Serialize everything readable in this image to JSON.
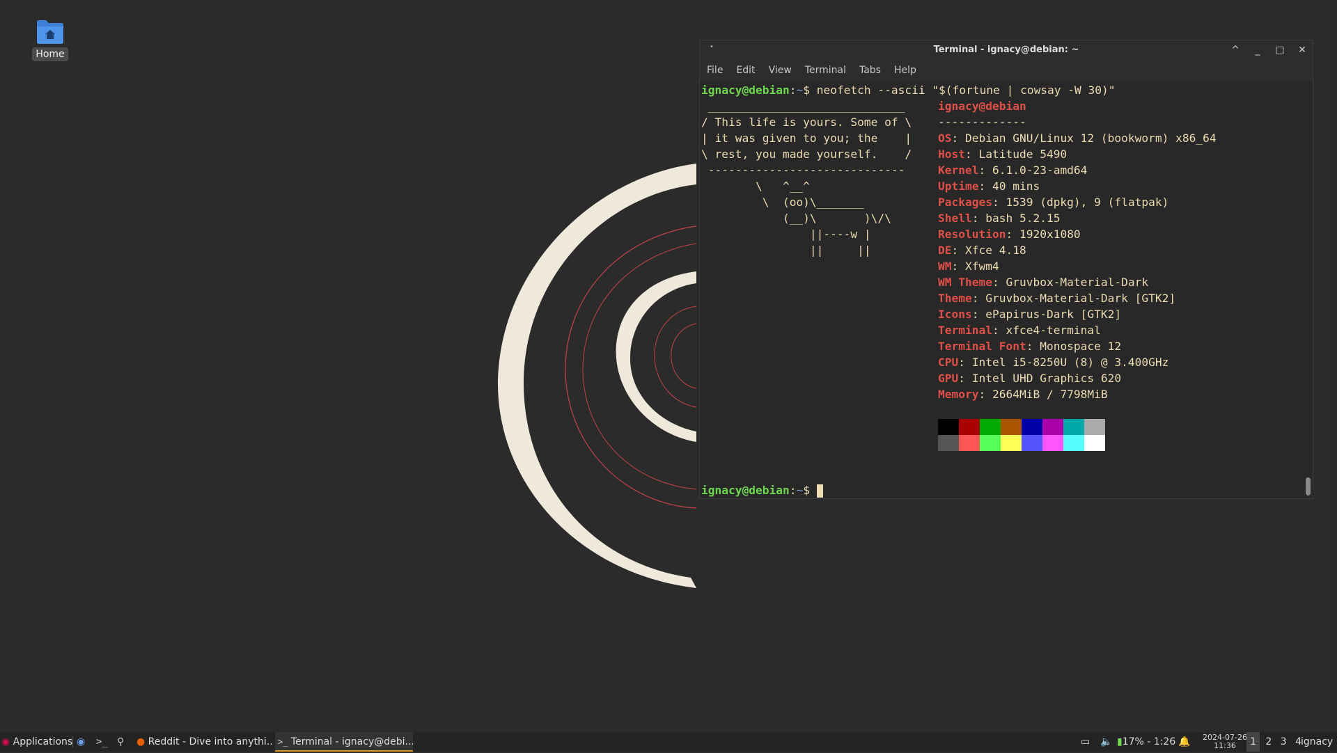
{
  "desktop": {
    "icons": [
      {
        "label": "Home",
        "icon": "home-folder-icon"
      }
    ]
  },
  "terminal": {
    "title": "Terminal - ignacy@debian: ~",
    "menu": [
      "File",
      "Edit",
      "View",
      "Terminal",
      "Tabs",
      "Help"
    ],
    "prompt_user": "ignacy@debian",
    "prompt_path": "~",
    "prompt_symbol": "$",
    "command": "neofetch --ascii \"$(fortune | cowsay -W 30)\"",
    "cowsay": [
      " _____________________________",
      "/ This life is yours. Some of \\",
      "| it was given to you; the    |",
      "\\ rest, you made yourself.    /",
      " -----------------------------",
      "        \\   ^__^",
      "         \\  (oo)\\_______",
      "            (__)\\       )\\/\\",
      "                ||----w |",
      "                ||     ||"
    ],
    "header": "ignacy@debian",
    "separator": "-------------",
    "info": [
      {
        "key": "OS",
        "value": "Debian GNU/Linux 12 (bookworm) x86_64"
      },
      {
        "key": "Host",
        "value": "Latitude 5490"
      },
      {
        "key": "Kernel",
        "value": "6.1.0-23-amd64"
      },
      {
        "key": "Uptime",
        "value": "40 mins"
      },
      {
        "key": "Packages",
        "value": "1539 (dpkg), 9 (flatpak)"
      },
      {
        "key": "Shell",
        "value": "bash 5.2.15"
      },
      {
        "key": "Resolution",
        "value": "1920x1080"
      },
      {
        "key": "DE",
        "value": "Xfce 4.18"
      },
      {
        "key": "WM",
        "value": "Xfwm4"
      },
      {
        "key": "WM Theme",
        "value": "Gruvbox-Material-Dark"
      },
      {
        "key": "Theme",
        "value": "Gruvbox-Material-Dark [GTK2]"
      },
      {
        "key": "Icons",
        "value": "ePapirus-Dark [GTK2]"
      },
      {
        "key": "Terminal",
        "value": "xfce4-terminal"
      },
      {
        "key": "Terminal Font",
        "value": "Monospace 12"
      },
      {
        "key": "CPU",
        "value": "Intel i5-8250U (8) @ 3.400GHz"
      },
      {
        "key": "GPU",
        "value": "Intel UHD Graphics 620"
      },
      {
        "key": "Memory",
        "value": "2664MiB / 7798MiB"
      }
    ],
    "colors_normal": [
      "#000000",
      "#aa0000",
      "#00aa00",
      "#aa5500",
      "#0000aa",
      "#aa00aa",
      "#00aaaa",
      "#aaaaaa"
    ],
    "colors_bright": [
      "#555555",
      "#ff5555",
      "#55ff55",
      "#ffff55",
      "#5555ff",
      "#ff55ff",
      "#55ffff",
      "#ffffff"
    ]
  },
  "taskbar": {
    "applications_label": "Applications",
    "tasks": [
      {
        "label": "Reddit - Dive into anythi...",
        "icon": "firefox-icon",
        "active": false
      },
      {
        "label": "Terminal - ignacy@debi...",
        "icon": "terminal-icon",
        "active": true
      }
    ],
    "battery": "17% - 1:26",
    "date": "2024-07-26",
    "time": "11:36",
    "workspaces": [
      "1",
      "2",
      "3",
      "4"
    ],
    "user": "ignacy"
  }
}
